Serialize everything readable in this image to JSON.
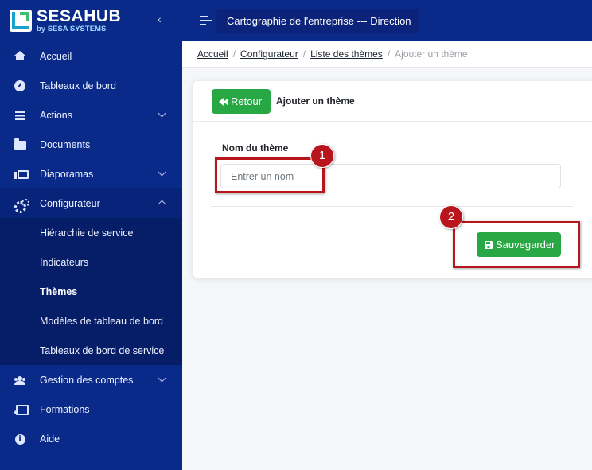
{
  "brand": {
    "name_part1": "SESA",
    "name_part2": "HUB",
    "tagline": "by SESA SYSTEMS",
    "colors": {
      "sidebar": "#0a2a8a",
      "accent_green": "#28a745",
      "annotation_red": "#b8161c"
    }
  },
  "header": {
    "title": "Cartographie de l'entreprise --- Direction"
  },
  "sidebar": {
    "items": [
      {
        "label": "Accueil",
        "icon": "home-icon"
      },
      {
        "label": "Tableaux de bord",
        "icon": "gauge-icon"
      },
      {
        "label": "Actions",
        "icon": "list-icon"
      },
      {
        "label": "Documents",
        "icon": "folder-icon"
      },
      {
        "label": "Diaporamas",
        "icon": "presentation-icon"
      },
      {
        "label": "Configurateur",
        "icon": "cogs-icon"
      }
    ],
    "sub_items": [
      {
        "label": "Hiérarchie de service"
      },
      {
        "label": "Indicateurs"
      },
      {
        "label": "Thèmes"
      },
      {
        "label": "Modèles de tableau de bord"
      },
      {
        "label": "Tableaux de bord de service"
      }
    ],
    "items_after": [
      {
        "label": "Gestion des comptes",
        "icon": "users-icon"
      },
      {
        "label": "Formations",
        "icon": "board-icon"
      },
      {
        "label": "Aide",
        "icon": "info-icon"
      }
    ]
  },
  "breadcrumb": {
    "items": [
      "Accueil",
      "Configurateur",
      "Liste des thèmes"
    ],
    "current": "Ajouter un thème",
    "separator": "/"
  },
  "card": {
    "back_label": "Retour",
    "title": "Ajouter un thème",
    "field_label": "Nom du thème",
    "field_placeholder": "Entrer un nom",
    "save_label": "Sauvegarder"
  },
  "annotations": {
    "step1": "1",
    "step2": "2"
  }
}
